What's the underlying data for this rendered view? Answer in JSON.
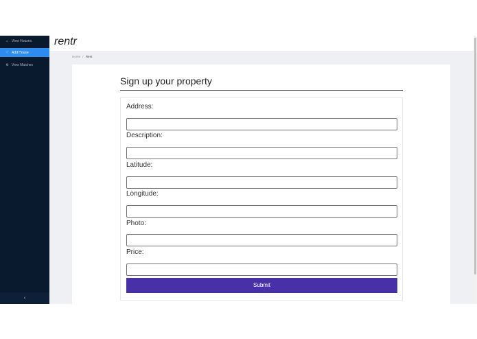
{
  "sidebar": {
    "items": [
      {
        "label": "View Houses",
        "icon": "home-icon",
        "glyph": "⌂",
        "active": false
      },
      {
        "label": "Add House",
        "icon": "add-house-icon",
        "glyph": "♡",
        "active": true
      },
      {
        "label": "View Matches",
        "icon": "matches-icon",
        "glyph": "⚙",
        "active": false
      }
    ],
    "collapse_glyph": "‹"
  },
  "header": {
    "logo": "rentr"
  },
  "breadcrumb": {
    "home": "Home",
    "separator": "/",
    "current": "Rent"
  },
  "form": {
    "title": "Sign up your property",
    "fields": [
      {
        "label": "Address:",
        "value": ""
      },
      {
        "label": "Description:",
        "value": ""
      },
      {
        "label": "Latitude:",
        "value": ""
      },
      {
        "label": "Longitude:",
        "value": ""
      },
      {
        "label": "Photo:",
        "value": ""
      },
      {
        "label": "Price:",
        "value": ""
      }
    ],
    "submit_label": "Submit"
  },
  "colors": {
    "sidebar_bg": "#091a2e",
    "active_item": "#2d8cf0",
    "submit_bg": "#4830a8",
    "content_bg": "#eef0f3"
  }
}
